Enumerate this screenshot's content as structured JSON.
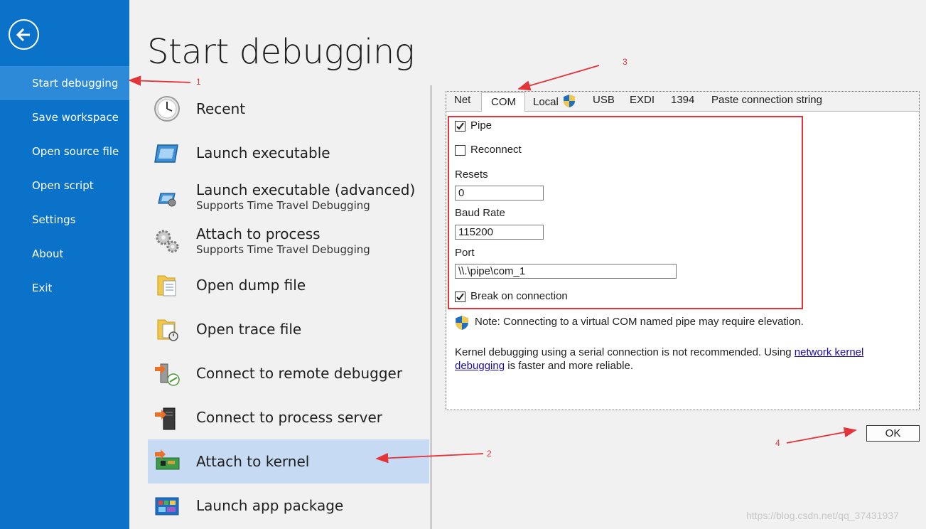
{
  "sidebar": {
    "items": [
      {
        "label": "Start debugging"
      },
      {
        "label": "Save workspace"
      },
      {
        "label": "Open source file"
      },
      {
        "label": "Open script"
      },
      {
        "label": "Settings"
      },
      {
        "label": "About"
      },
      {
        "label": "Exit"
      }
    ]
  },
  "page_title": "Start debugging",
  "options": [
    {
      "label": "Recent",
      "icon": "clock-icon"
    },
    {
      "label": "Launch executable",
      "icon": "window-icon"
    },
    {
      "label": "Launch executable (advanced)",
      "sub": "Supports Time Travel Debugging",
      "icon": "window-gear-icon"
    },
    {
      "label": "Attach to process",
      "sub": "Supports Time Travel Debugging",
      "icon": "gears-icon"
    },
    {
      "label": "Open dump file",
      "icon": "dump-file-icon"
    },
    {
      "label": "Open trace file",
      "icon": "trace-file-icon"
    },
    {
      "label": "Connect to remote debugger",
      "icon": "remote-debugger-icon"
    },
    {
      "label": "Connect to process server",
      "icon": "process-server-icon"
    },
    {
      "label": "Attach to kernel",
      "icon": "circuit-board-icon"
    },
    {
      "label": "Launch app package",
      "icon": "app-package-icon"
    }
  ],
  "tabs": [
    "Net",
    "COM",
    "Local",
    "USB",
    "EXDI",
    "1394",
    "Paste connection string"
  ],
  "com": {
    "pipe_label": "Pipe",
    "pipe_checked": true,
    "reconnect_label": "Reconnect",
    "reconnect_checked": false,
    "resets_label": "Resets",
    "resets_value": "0",
    "baud_label": "Baud Rate",
    "baud_value": "115200",
    "port_label": "Port",
    "port_value": "\\\\.\\pipe\\com_1",
    "break_label": "Break on connection",
    "break_checked": true,
    "note": "Note: Connecting to a virtual COM named pipe may require elevation.",
    "desc_prefix": "Kernel debugging using a serial connection is not recommended. Using ",
    "desc_link": "network kernel debugging",
    "desc_suffix": " is faster and more reliable."
  },
  "ok_label": "OK",
  "annotations": [
    "1",
    "2",
    "3",
    "4"
  ],
  "watermark": "https://blog.csdn.net/qq_37431937",
  "colors": {
    "sidebar": "#0a72c9",
    "sidebar_active": "#2c8ad8",
    "selected_option": "#c6daf4",
    "annotation": "#e5333a"
  }
}
